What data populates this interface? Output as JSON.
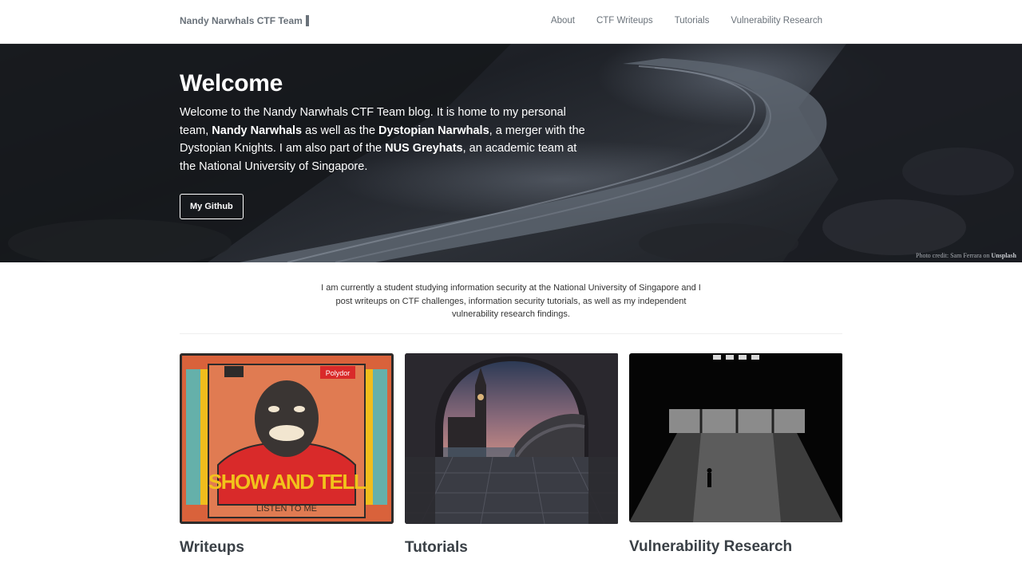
{
  "navbar": {
    "brand": "Nandy Narwhals CTF Team",
    "links": [
      "About",
      "CTF Writeups",
      "Tutorials",
      "Vulnerability Research"
    ]
  },
  "hero": {
    "title": "Welcome",
    "text_1": "Welcome to the Nandy Narwhals CTF Team blog. It is home to my personal team, ",
    "bold_1": "Nandy Narwhals",
    "text_2": " as well as the ",
    "bold_2": "Dystopian Narwhals",
    "text_3": ", a merger with the Dystopian Knights. I am also part of the ",
    "bold_3": "NUS Greyhats",
    "text_4": ", an academic team at the National University of Singapore.",
    "button": "My Github",
    "credit_prefix": "Photo credit: Sam Ferrara on ",
    "credit_site": "Unsplash"
  },
  "intro": "I am currently a student studying information security at the National University of Singapore and I post writeups on CTF challenges, information security tutorials, as well as my independent vulnerability research findings.",
  "cards": [
    {
      "title": "Writeups",
      "album_text": "SHOW AND TELL",
      "album_sub": "LISTEN TO ME",
      "album_logo": "Polydor"
    },
    {
      "title": "Tutorials"
    },
    {
      "title": "Vulnerability Research"
    }
  ],
  "colors": {
    "nav_text": "#6a727a",
    "card_title": "#3a4046",
    "album_bg": "#d9623b",
    "album_shirt": "#d92a2a",
    "album_text": "#f2c21b"
  }
}
